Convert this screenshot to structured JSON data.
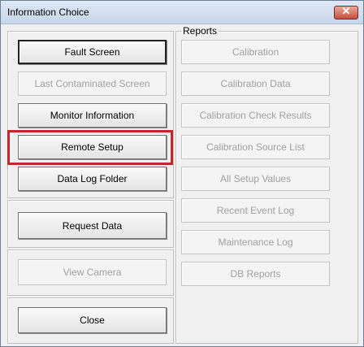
{
  "window": {
    "title": "Information Choice",
    "close_glyph": "✕"
  },
  "left_buttons": {
    "fault_screen": "Fault Screen",
    "last_contaminated_screen": "Last Contaminated Screen",
    "monitor_information": "Monitor Information",
    "remote_setup": "Remote Setup",
    "data_log_folder": "Data Log Folder",
    "request_data": "Request Data",
    "view_camera": "View Camera",
    "close": "Close"
  },
  "reports": {
    "label": "Reports",
    "buttons": [
      "Calibration",
      "Calibration Data",
      "Calibration Check Results",
      "Calibration Source List",
      "All Setup Values",
      "Recent Event Log",
      "Maintenance Log",
      "DB Reports"
    ]
  },
  "colors": {
    "highlight": "#c1272d"
  }
}
